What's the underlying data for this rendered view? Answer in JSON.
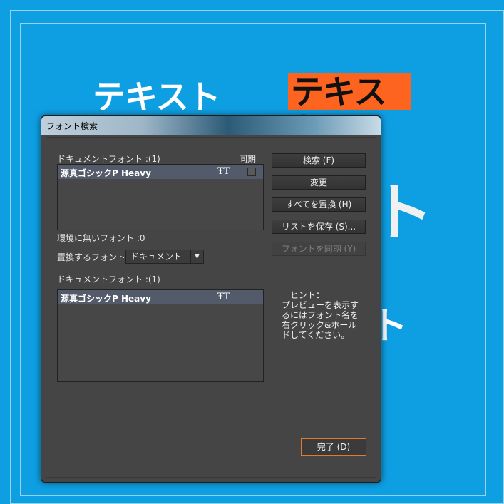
{
  "canvas": {
    "text1": "テキスト",
    "text2": "テキスト",
    "text3": "ト",
    "text4": "ト",
    "highlight_color": "#fd6420",
    "background_color": "#0e9fe3"
  },
  "dialog": {
    "title": "フォント検索",
    "document_fonts_label": "ドキュメントフォント :(1)",
    "sync_label": "同期",
    "document_fonts": [
      {
        "name": "源真ゴシックP Heavy",
        "icon": "truetype-font-icon"
      }
    ],
    "missing_fonts_label": "環境に無いフォント :0",
    "replace_with_label": "置換するフォント :",
    "replace_with_value": "ドキュメント",
    "replace_list_label": "ドキュメントフォント :(1)",
    "replace_fonts": [
      {
        "name": "源真ゴシックP Heavy",
        "icon": "truetype-font-icon"
      }
    ],
    "buttons": {
      "find": "検索 (F)",
      "change": "変更",
      "change_all": "すべてを置換 (H)",
      "save_list": "リストを保存 (S)...",
      "sync_fonts": "フォントを同期 (Y)",
      "done": "完了 (D)"
    },
    "hint_title": "ヒント：",
    "hint_body": "プレビューを表示するにはフォント名を右クリック&ホールドしてください。"
  }
}
